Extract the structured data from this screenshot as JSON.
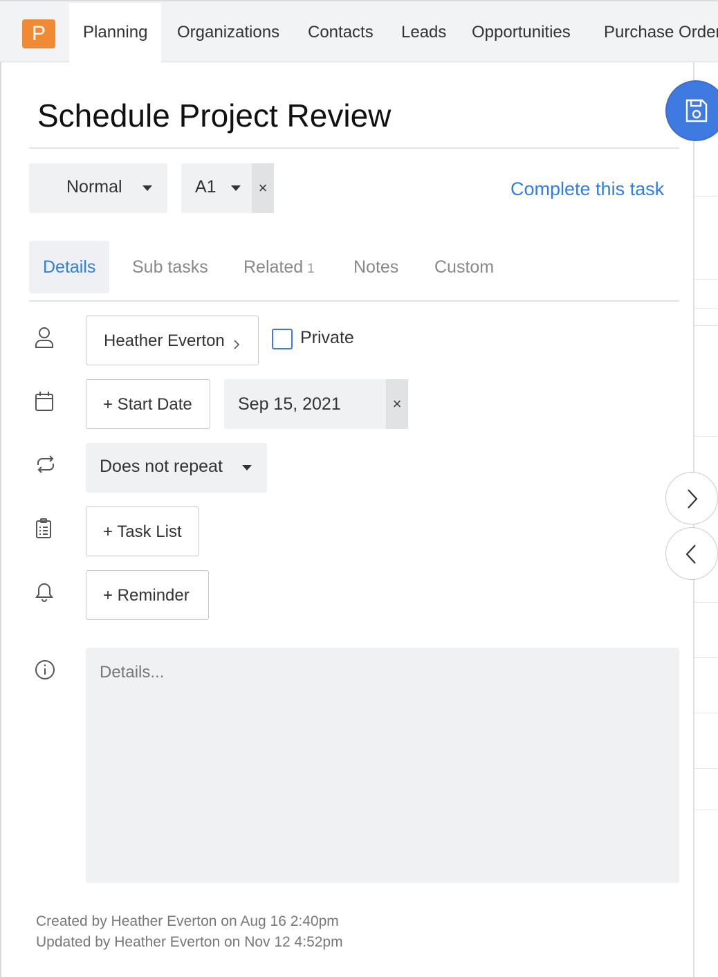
{
  "app": {
    "logo_letter": "P",
    "brand_color": "#f08a35",
    "accent_color": "#2f7ee0"
  },
  "nav": {
    "tabs": [
      {
        "label": "Planning",
        "active": true
      },
      {
        "label": "Organizations"
      },
      {
        "label": "Contacts"
      },
      {
        "label": "Leads"
      },
      {
        "label": "Opportunities"
      },
      {
        "label": "Purchase Order"
      }
    ]
  },
  "task": {
    "title": "Schedule Project Review",
    "priority": "Normal",
    "assignee_code": "A1",
    "complete_label": "Complete this task",
    "clear_glyph": "×"
  },
  "tabs": [
    {
      "label": "Details",
      "active": true
    },
    {
      "label": "Sub tasks"
    },
    {
      "label": "Related",
      "badge": "1"
    },
    {
      "label": "Notes"
    },
    {
      "label": "Custom"
    }
  ],
  "fields": {
    "owner": "Heather Everton",
    "private_label": "Private",
    "private_checked": false,
    "start_date_label": "+ Start Date",
    "due_date": "Sep 15, 2021",
    "repeat": "Does not repeat",
    "task_list_label": "+ Task List",
    "reminder_label": "+ Reminder",
    "details_placeholder": "Details..."
  },
  "meta": {
    "created": "Created by Heather Everton on Aug 16 2:40pm",
    "updated": "Updated by Heather Everton on Nov 12 4:52pm"
  },
  "icons": {
    "save": "save-icon",
    "next": "chevron-right-icon",
    "prev": "chevron-left-icon",
    "owner": "user-icon",
    "date": "calendar-icon",
    "repeat": "repeat-icon",
    "task_list": "clipboard-list-icon",
    "reminder": "bell-icon",
    "details": "info-icon"
  }
}
